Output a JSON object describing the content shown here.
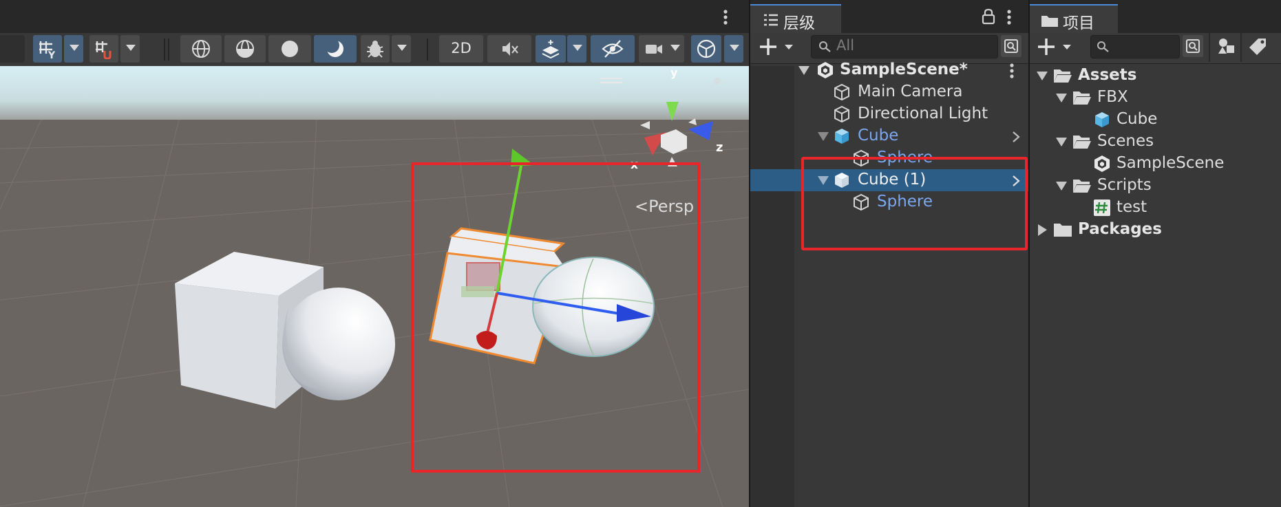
{
  "scene": {
    "toolbar": {
      "mode_2d_label": "2D"
    },
    "persp_label": "Persp",
    "gizmo": {
      "y_label": "y",
      "z_label": "z",
      "x_label": "x"
    }
  },
  "hierarchy": {
    "tab_label": "层级",
    "search_placeholder": "All",
    "items": [
      {
        "label": "SampleScene*",
        "kind": "scene"
      },
      {
        "label": "Main Camera",
        "kind": "gameobject"
      },
      {
        "label": "Directional Light",
        "kind": "gameobject"
      },
      {
        "label": "Cube",
        "kind": "prefab"
      },
      {
        "label": "Sphere",
        "kind": "prefab-child"
      },
      {
        "label": "Cube (1)",
        "kind": "prefab",
        "selected": true
      },
      {
        "label": "Sphere",
        "kind": "prefab-child"
      }
    ]
  },
  "project": {
    "tab_label": "项目",
    "tree": [
      {
        "label": "Assets"
      },
      {
        "label": "FBX"
      },
      {
        "label": "Cube"
      },
      {
        "label": "Scenes"
      },
      {
        "label": "SampleScene"
      },
      {
        "label": "Scripts"
      },
      {
        "label": "test"
      },
      {
        "label": "Packages"
      }
    ]
  },
  "colors": {
    "selection": "#2c5d87",
    "prefab_text": "#7aa7f0",
    "annotation": "#e8252b",
    "axis_x": "#d63a3a",
    "axis_y": "#6bd42f",
    "axis_z": "#2f5df0"
  }
}
